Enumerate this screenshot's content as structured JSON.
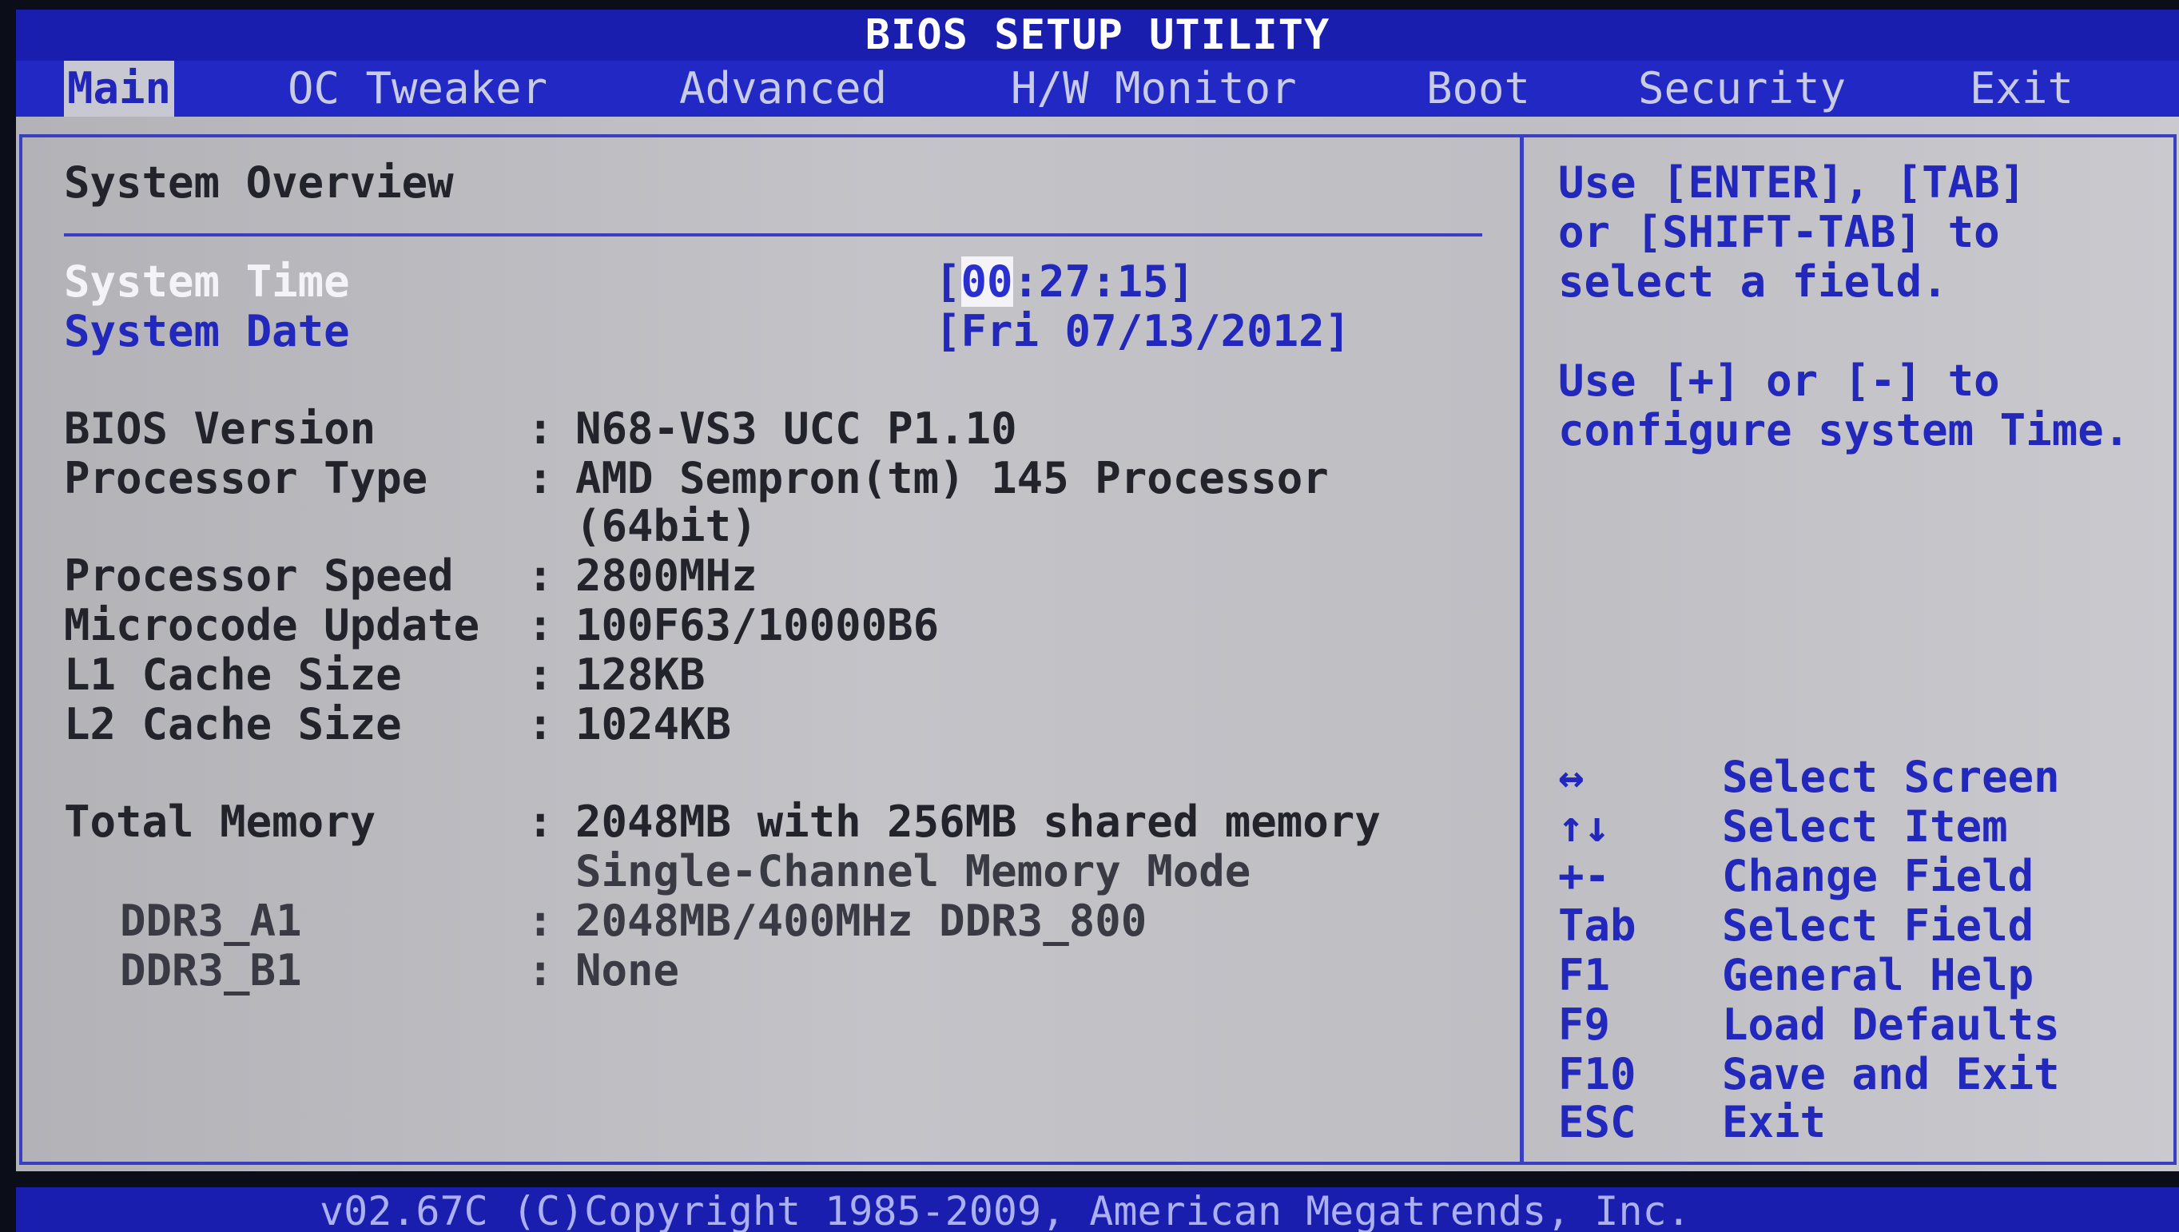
{
  "window": {
    "title": "BIOS SETUP UTILITY"
  },
  "menu": {
    "items": [
      {
        "label": "Main",
        "active": true
      },
      {
        "label": "OC Tweaker",
        "active": false
      },
      {
        "label": "Advanced",
        "active": false
      },
      {
        "label": "H/W Monitor",
        "active": false
      },
      {
        "label": "Boot",
        "active": false
      },
      {
        "label": "Security",
        "active": false
      },
      {
        "label": "Exit",
        "active": false
      }
    ]
  },
  "main": {
    "section_title": "System Overview",
    "system_time": {
      "label": "System Time",
      "value_prefix": "[",
      "value_cursor": "00",
      "value_rest": ":27:15]"
    },
    "system_date": {
      "label": "System Date",
      "value": "[Fri 07/13/2012]"
    },
    "info_rows": [
      {
        "label": "BIOS Version",
        "sep": ":",
        "value": "N68-VS3 UCC P1.10"
      },
      {
        "label": "Processor Type",
        "sep": ":",
        "value": "AMD Sempron(tm) 145 Processor",
        "value2": "(64bit)"
      },
      {
        "label": "Processor Speed",
        "sep": ":",
        "value": "2800MHz"
      },
      {
        "label": "Microcode Update",
        "sep": ":",
        "value": "100F63/10000B6"
      },
      {
        "label": "L1 Cache Size",
        "sep": ":",
        "value": "128KB"
      },
      {
        "label": "L2 Cache Size",
        "sep": ":",
        "value": "1024KB"
      }
    ],
    "memory": {
      "label": "Total Memory",
      "sep": ":",
      "value": "2048MB with 256MB shared memory",
      "value2": "Single-Channel Memory Mode",
      "slots": [
        {
          "label": "DDR3_A1",
          "sep": ":",
          "value": "2048MB/400MHz  DDR3_800"
        },
        {
          "label": "DDR3_B1",
          "sep": ":",
          "value": "None"
        }
      ]
    }
  },
  "help": {
    "lines": [
      "Use [ENTER], [TAB]",
      "or [SHIFT-TAB] to",
      "select a field.",
      "",
      "Use [+] or [-] to",
      "configure system Time."
    ],
    "keys": [
      {
        "key": "↔",
        "action": "Select Screen"
      },
      {
        "key": "↑↓",
        "action": "Select Item"
      },
      {
        "key": "+-",
        "action": "Change Field"
      },
      {
        "key": "Tab",
        "action": "Select Field"
      },
      {
        "key": "F1",
        "action": "General Help"
      },
      {
        "key": "F9",
        "action": "Load Defaults"
      },
      {
        "key": "F10",
        "action": "Save and Exit"
      },
      {
        "key": "ESC",
        "action": "Exit"
      }
    ]
  },
  "footer": {
    "copyright": "v02.67C (C)Copyright 1985-2009, American Megatrends, Inc."
  }
}
